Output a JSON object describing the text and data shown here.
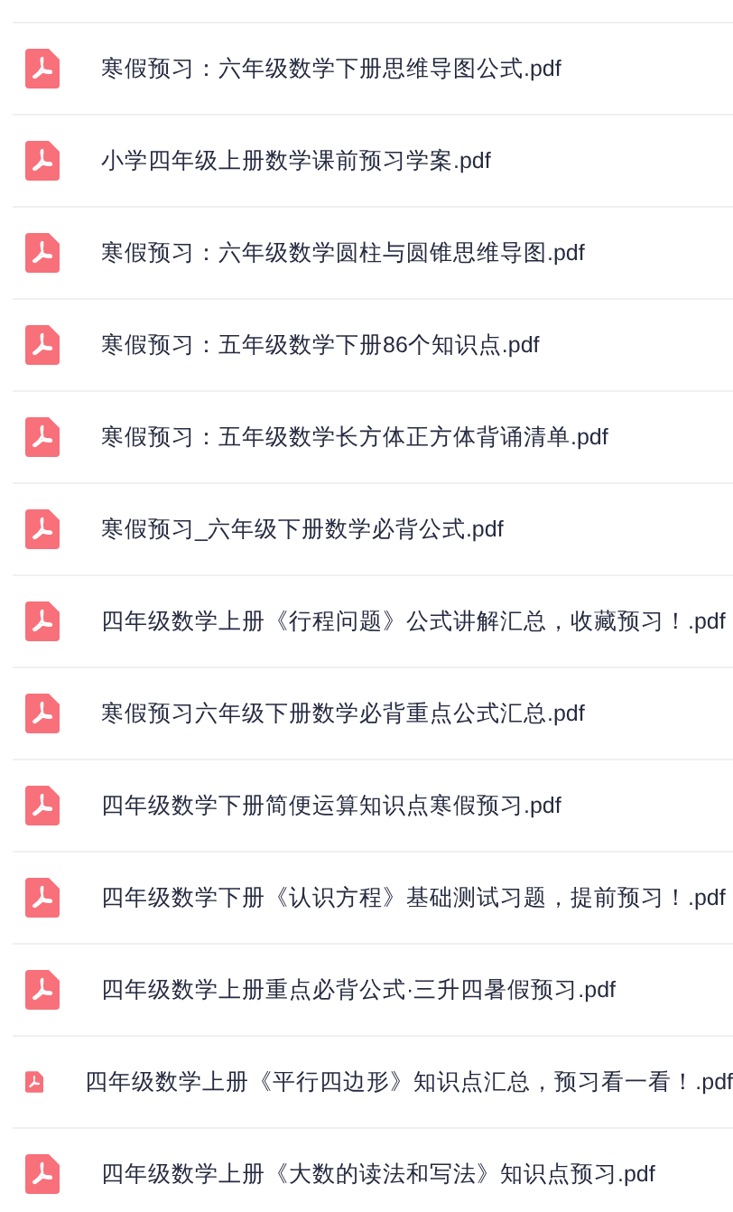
{
  "files": [
    {
      "name": "寒假预习：六年级数学下册思维导图公式.pdf"
    },
    {
      "name": "小学四年级上册数学课前预习学案.pdf"
    },
    {
      "name": "寒假预习：六年级数学圆柱与圆锥思维导图.pdf"
    },
    {
      "name": "寒假预习：五年级数学下册86个知识点.pdf"
    },
    {
      "name": "寒假预习：五年级数学长方体正方体背诵清单.pdf"
    },
    {
      "name": "寒假预习_六年级下册数学必背公式.pdf"
    },
    {
      "name": "四年级数学上册《行程问题》公式讲解汇总，收藏预习！.pdf"
    },
    {
      "name": "寒假预习六年级下册数学必背重点公式汇总.pdf"
    },
    {
      "name": "四年级数学下册简便运算知识点寒假预习.pdf"
    },
    {
      "name": "四年级数学下册《认识方程》基础测试习题，提前预习！.pdf"
    },
    {
      "name": "四年级数学上册重点必背公式·三升四暑假预习.pdf"
    },
    {
      "name": "四年级数学上册《平行四边形》知识点汇总，预习看一看！.pdf"
    },
    {
      "name": "四年级数学上册《大数的读法和写法》知识点预习.pdf"
    }
  ]
}
